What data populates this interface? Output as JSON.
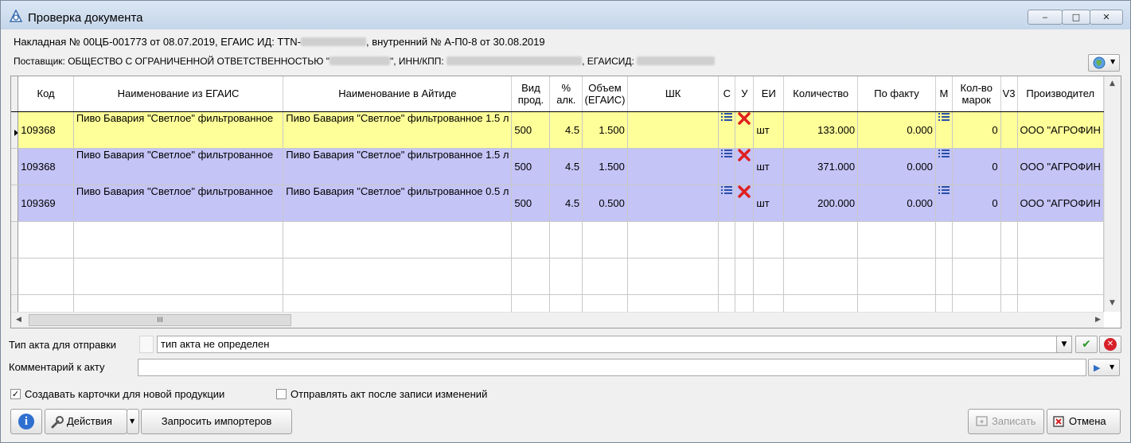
{
  "window": {
    "title": "Проверка документа",
    "controls": {
      "minimize": "‒",
      "maximize": "□",
      "close": "✕"
    }
  },
  "header": {
    "invoice_line_a": "Накладная № 00ЦБ-001773 от 08.07.2019, ЕГАИС ИД: TTN-",
    "invoice_line_b": ", внутренний № А-П0-8 от 30.08.2019",
    "supplier_line_a": "Поставщик: ОБЩЕСТВО С ОГРАНИЧЕННОЙ ОТВЕТСТВЕННОСТЬЮ \"",
    "supplier_line_b": "\", ИНН/КПП:",
    "supplier_line_c": ", ЕГАИСИД:"
  },
  "grid": {
    "columns": [
      {
        "key": "code",
        "label": "Код"
      },
      {
        "key": "egais_name",
        "label": "Наименование из ЕГАИС"
      },
      {
        "key": "local_name",
        "label": "Наименование в Айтиде"
      },
      {
        "key": "kind",
        "label": "Вид\nпрод."
      },
      {
        "key": "alc",
        "label": "%\nалк."
      },
      {
        "key": "volume",
        "label": "Объем\n(ЕГАИС)"
      },
      {
        "key": "barcode",
        "label": "ШК"
      },
      {
        "key": "c",
        "label": "С"
      },
      {
        "key": "u",
        "label": "У"
      },
      {
        "key": "unit",
        "label": "ЕИ"
      },
      {
        "key": "qty",
        "label": "Количество"
      },
      {
        "key": "actual",
        "label": "По факту"
      },
      {
        "key": "m",
        "label": "М"
      },
      {
        "key": "marks",
        "label": "Кол-во\nмарок"
      },
      {
        "key": "v3",
        "label": "V3"
      },
      {
        "key": "maker",
        "label": "Производител"
      }
    ],
    "rows": [
      {
        "code": "109368",
        "egais_name": "Пиво Бавария \"Светлое\" фильтрованное",
        "local_name": "Пиво Бавария \"Светлое\" фильтрованное 1.5 л",
        "kind": "500",
        "alc": "4.5",
        "volume": "1.500",
        "barcode": "",
        "unit": "шт",
        "qty": "133.000",
        "actual": "0.000",
        "marks": "0",
        "v3": "",
        "maker": "ООО \"АГРОФИН",
        "state": "active"
      },
      {
        "code": "109368",
        "egais_name": "Пиво Бавария \"Светлое\" фильтрованное",
        "local_name": "Пиво Бавария \"Светлое\" фильтрованное 1.5 л",
        "kind": "500",
        "alc": "4.5",
        "volume": "1.500",
        "barcode": "",
        "unit": "шт",
        "qty": "371.000",
        "actual": "0.000",
        "marks": "0",
        "v3": "",
        "maker": "ООО \"АГРОФИН",
        "state": "blue"
      },
      {
        "code": "109369",
        "egais_name": "Пиво Бавария \"Светлое\" фильтрованное",
        "local_name": "Пиво Бавария \"Светлое\" фильтрованное 0.5 л",
        "kind": "500",
        "alc": "4.5",
        "volume": "0.500",
        "barcode": "",
        "unit": "шт",
        "qty": "200.000",
        "actual": "0.000",
        "marks": "0",
        "v3": "",
        "maker": "ООО \"АГРОФИН",
        "state": "blue"
      }
    ],
    "empty_rows": 3,
    "hscroll_grip": "III",
    "colors": {
      "active_row": "#ffff99",
      "other_row": "#c4c4f7"
    }
  },
  "form": {
    "act_type_label": "Тип акта для отправки",
    "act_type_value": "тип акта не определен",
    "comment_label": "Комментарий к акту",
    "comment_value": "",
    "create_cards_label": "Создавать карточки для новой продукции",
    "create_cards_checked": true,
    "send_after_label": "Отправлять акт после записи изменений",
    "send_after_checked": false
  },
  "buttons": {
    "actions": "Действия",
    "request_importers": "Запросить импортеров",
    "save": "Записать",
    "cancel": "Отмена"
  }
}
